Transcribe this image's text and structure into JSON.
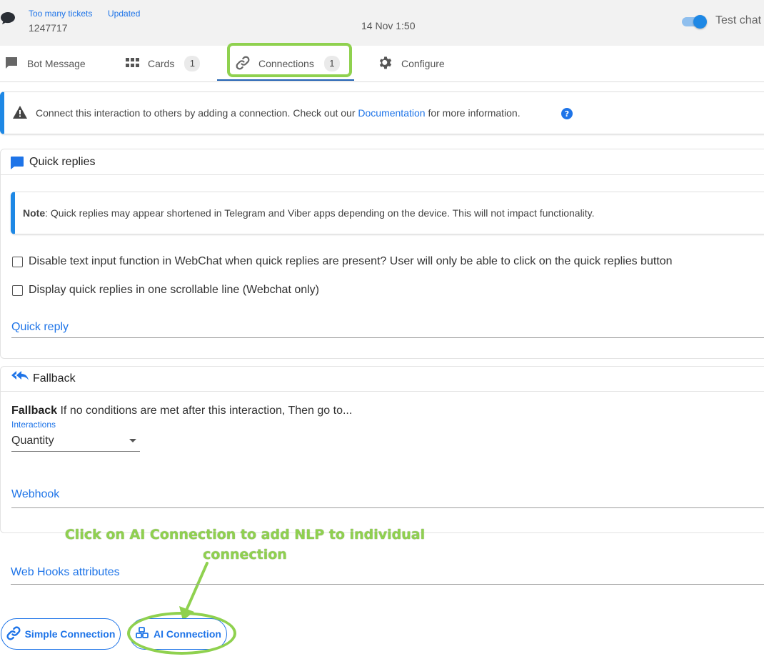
{
  "header": {
    "link_tickets": "Too many tickets",
    "link_updated": "Updated",
    "ticket_id": "1247717",
    "date": "14 Nov 1:50",
    "test_chat_label": "Test chat",
    "test_chat_on": true
  },
  "tabs": [
    {
      "label": "Bot Message",
      "icon": "message-icon"
    },
    {
      "label": "Cards",
      "count": "1",
      "icon": "grid-icon"
    },
    {
      "label": "Connections",
      "count": "1",
      "icon": "link-icon",
      "active": true
    },
    {
      "label": "Configure",
      "icon": "gear-icon"
    }
  ],
  "info_banner": {
    "text_before": "Connect this interaction to others by adding a connection. Check out our ",
    "link": "Documentation",
    "text_after": " for more information."
  },
  "quick_replies": {
    "title": "Quick replies",
    "note_label": "Note",
    "note_text": ": Quick replies may appear shortened in Telegram and Viber apps depending on the device. This will not impact functionality.",
    "checkbox_disable_input": "Disable text input function in WebChat when quick replies are present?  User will only be able to click on the quick replies button",
    "checkbox_scrollable": "Display quick replies in one scrollable line (Webchat only)",
    "field_label": "Quick reply"
  },
  "fallback": {
    "title": "Fallback",
    "desc_bold": "Fallback",
    "desc_text": " If no conditions are met after this interaction, Then go to...",
    "select_label": "Interactions",
    "select_value": "Quantity",
    "webhook_label": "Webhook"
  },
  "webhooks_attributes_label": "Web Hooks attributes",
  "annotation": {
    "line1": "Click on AI Connection to add NLP to individual",
    "line2": "connection"
  },
  "buttons": {
    "simple_connection": "Simple Connection",
    "ai_connection": "AI Connection"
  },
  "colors": {
    "accent": "#1e74e8",
    "highlight": "#8fd14f"
  }
}
